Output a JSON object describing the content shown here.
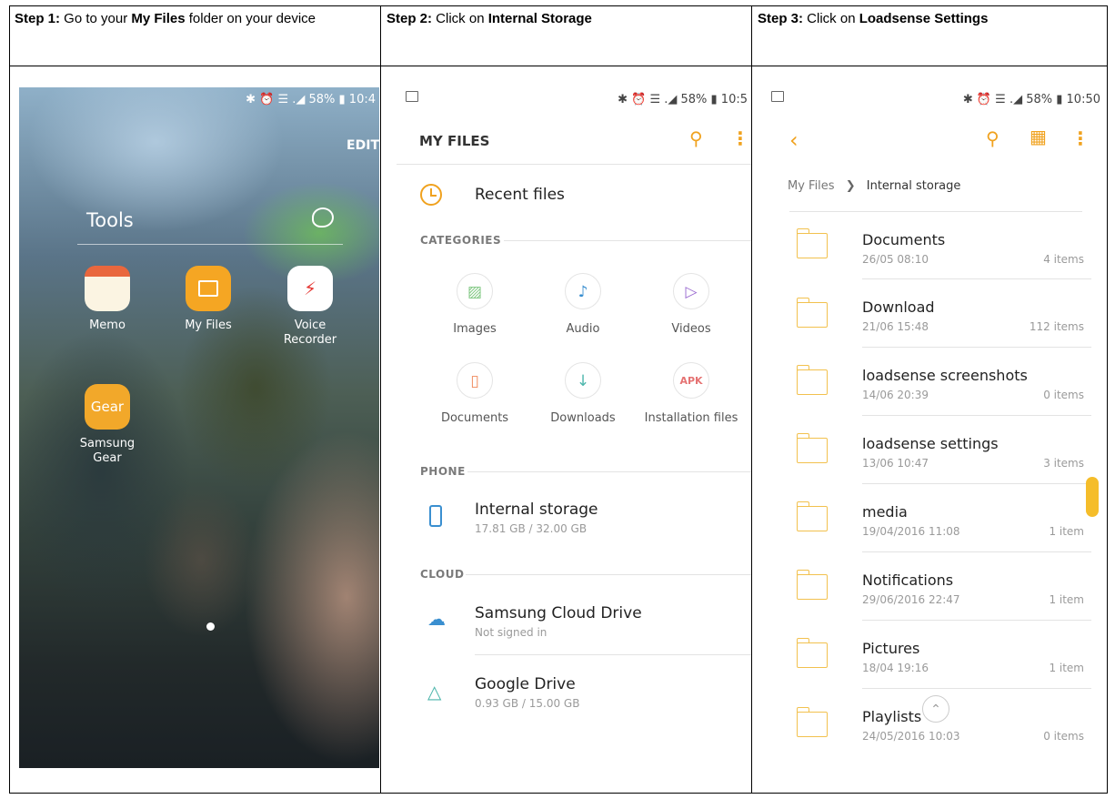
{
  "steps": [
    {
      "label": "Step 1:",
      "pre": " Go to your ",
      "bold": "My Files",
      "post": " folder on your device"
    },
    {
      "label": "Step 2:",
      "pre": " Click on ",
      "bold": "Internal Storage",
      "post": ""
    },
    {
      "label": "Step 3:",
      "pre": " Click on ",
      "bold": "Loadsense Settings",
      "post": ""
    }
  ],
  "panel1": {
    "status": "✱ ⏰ ☰ .◢ 58% ▮ 10:4",
    "edit": "EDIT",
    "folder_title": "Tools",
    "apps": [
      {
        "name": "Memo",
        "icon": "memo-icon"
      },
      {
        "name": "My Files",
        "icon": "folder-icon"
      },
      {
        "name": "Voice Recorder",
        "icon": "voice-recorder-icon",
        "glyph": "⚡"
      },
      {
        "name": "Samsung Gear",
        "icon": "gear-app-icon",
        "glyph": "Gear"
      }
    ]
  },
  "panel2": {
    "status": "✱ ⏰ ☰ .◢ 58% ▮ 10:5",
    "title": "MY FILES",
    "recent": "Recent files",
    "categories_label": "CATEGORIES",
    "categories": [
      {
        "name": "Images",
        "glyph": "▨",
        "color": "#7cc67e",
        "icon": "images-icon"
      },
      {
        "name": "Audio",
        "glyph": "♪",
        "color": "#3a8fd0",
        "icon": "audio-icon"
      },
      {
        "name": "Videos",
        "glyph": "▷",
        "color": "#9b6cd1",
        "icon": "videos-icon"
      },
      {
        "name": "Documents",
        "glyph": "▯",
        "color": "#f08a5d",
        "icon": "documents-icon"
      },
      {
        "name": "Downloads",
        "glyph": "↓",
        "color": "#4db6ac",
        "icon": "downloads-icon"
      },
      {
        "name": "Installation files",
        "glyph": "APK",
        "color": "#e57373",
        "icon": "apk-icon"
      }
    ],
    "phone_label": "PHONE",
    "internal": {
      "title": "Internal storage",
      "sub": "17.81 GB / 32.00 GB"
    },
    "cloud_label": "CLOUD",
    "samsung_cloud": {
      "title": "Samsung Cloud Drive",
      "sub": "Not signed in"
    },
    "google_drive": {
      "title": "Google Drive",
      "sub": "0.93 GB / 15.00 GB"
    }
  },
  "panel3": {
    "status": "✱ ⏰ ☰ .◢ 58% ▮ 10:50",
    "crumb_root": "My Files",
    "crumb_sep": "❯",
    "crumb_current": "Internal storage",
    "folders": [
      {
        "name": "Documents",
        "date": "26/05 08:10",
        "count": "4 items"
      },
      {
        "name": "Download",
        "date": "21/06 15:48",
        "count": "112 items"
      },
      {
        "name": "loadsense screenshots",
        "date": "14/06 20:39",
        "count": "0 items"
      },
      {
        "name": "loadsense settings",
        "date": "13/06 10:47",
        "count": "3 items"
      },
      {
        "name": "media",
        "date": "19/04/2016 11:08",
        "count": "1 item"
      },
      {
        "name": "Notifications",
        "date": "29/06/2016 22:47",
        "count": "1 item"
      },
      {
        "name": "Pictures",
        "date": "18/04 19:16",
        "count": "1 item"
      },
      {
        "name": "Playlists",
        "date": "24/05/2016 10:03",
        "count": "0 items"
      }
    ]
  }
}
